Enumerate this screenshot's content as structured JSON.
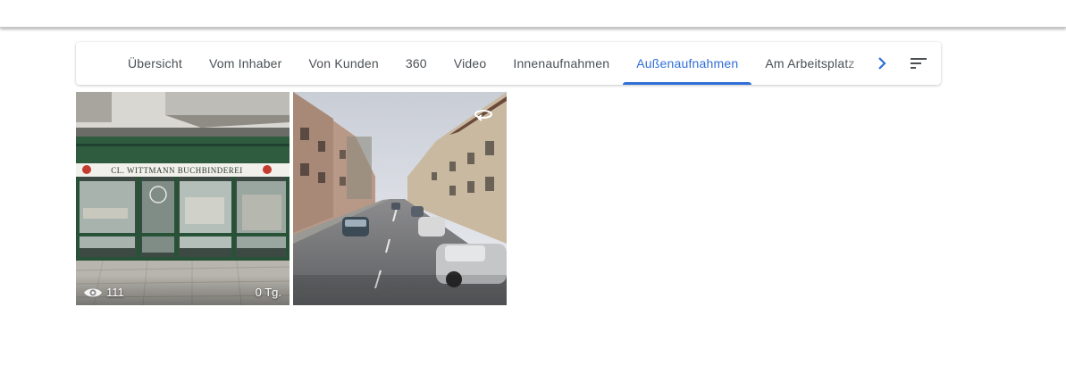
{
  "tabs": [
    {
      "label": "Übersicht"
    },
    {
      "label": "Vom Inhaber"
    },
    {
      "label": "Von Kunden"
    },
    {
      "label": "360"
    },
    {
      "label": "Video"
    },
    {
      "label": "Innenaufnahmen"
    },
    {
      "label": "Außenaufnahmen",
      "active": true
    },
    {
      "label": "Am Arbeitsplatz"
    }
  ],
  "colors": {
    "accent": "#2f6fd6",
    "tab_text": "#4a4f54"
  },
  "icons": {
    "scroll_next": "chevron-right-icon",
    "sort": "sort-icon",
    "views": "eye-icon",
    "pano": "360-rotate-icon"
  },
  "photos": [
    {
      "sign": "CL. WITTMANN  BUCHBINDEREI",
      "views": "111",
      "age": "0 Tg."
    },
    {
      "type": "360-street-view"
    }
  ]
}
